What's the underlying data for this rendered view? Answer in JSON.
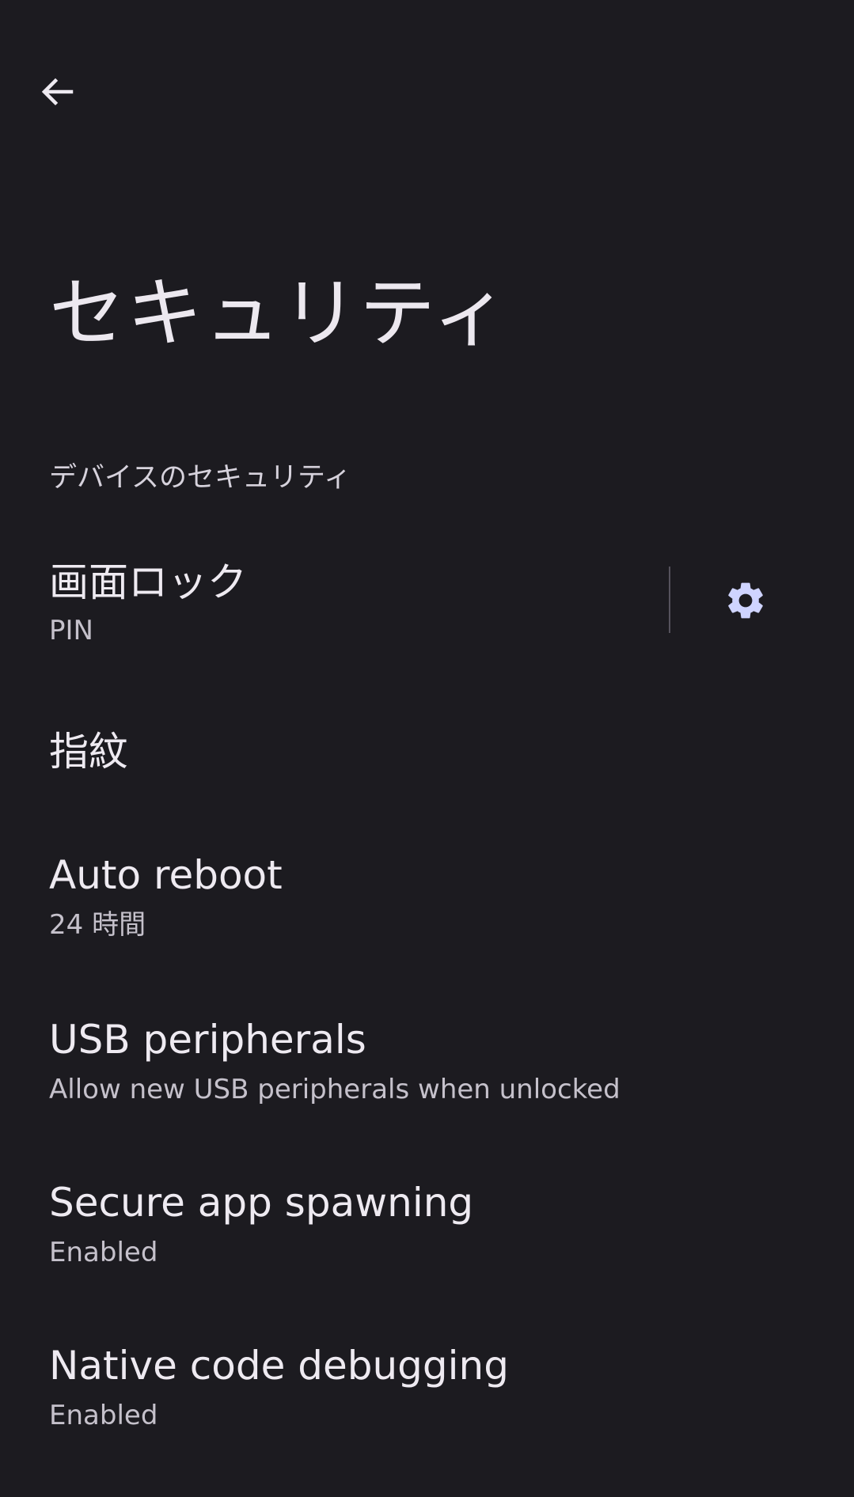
{
  "header": {
    "back_icon": "arrow-back-icon"
  },
  "page": {
    "title": "セキュリティ"
  },
  "section": {
    "header": "デバイスのセキュリティ"
  },
  "items": [
    {
      "title": "画面ロック",
      "summary": "PIN",
      "trailing_icon": "gear-icon"
    },
    {
      "title": "指紋",
      "summary": ""
    },
    {
      "title": "Auto reboot",
      "summary": "24 時間"
    },
    {
      "title": "USB peripherals",
      "summary": "Allow new USB peripherals when unlocked"
    },
    {
      "title": "Secure app spawning",
      "summary": "Enabled"
    },
    {
      "title": "Native code debugging",
      "summary": "Enabled"
    }
  ],
  "colors": {
    "background": "#1c1b20",
    "text_primary": "#eeeaf1",
    "text_secondary": "#c5c1cb",
    "icon_accent": "#cfd4ff"
  }
}
